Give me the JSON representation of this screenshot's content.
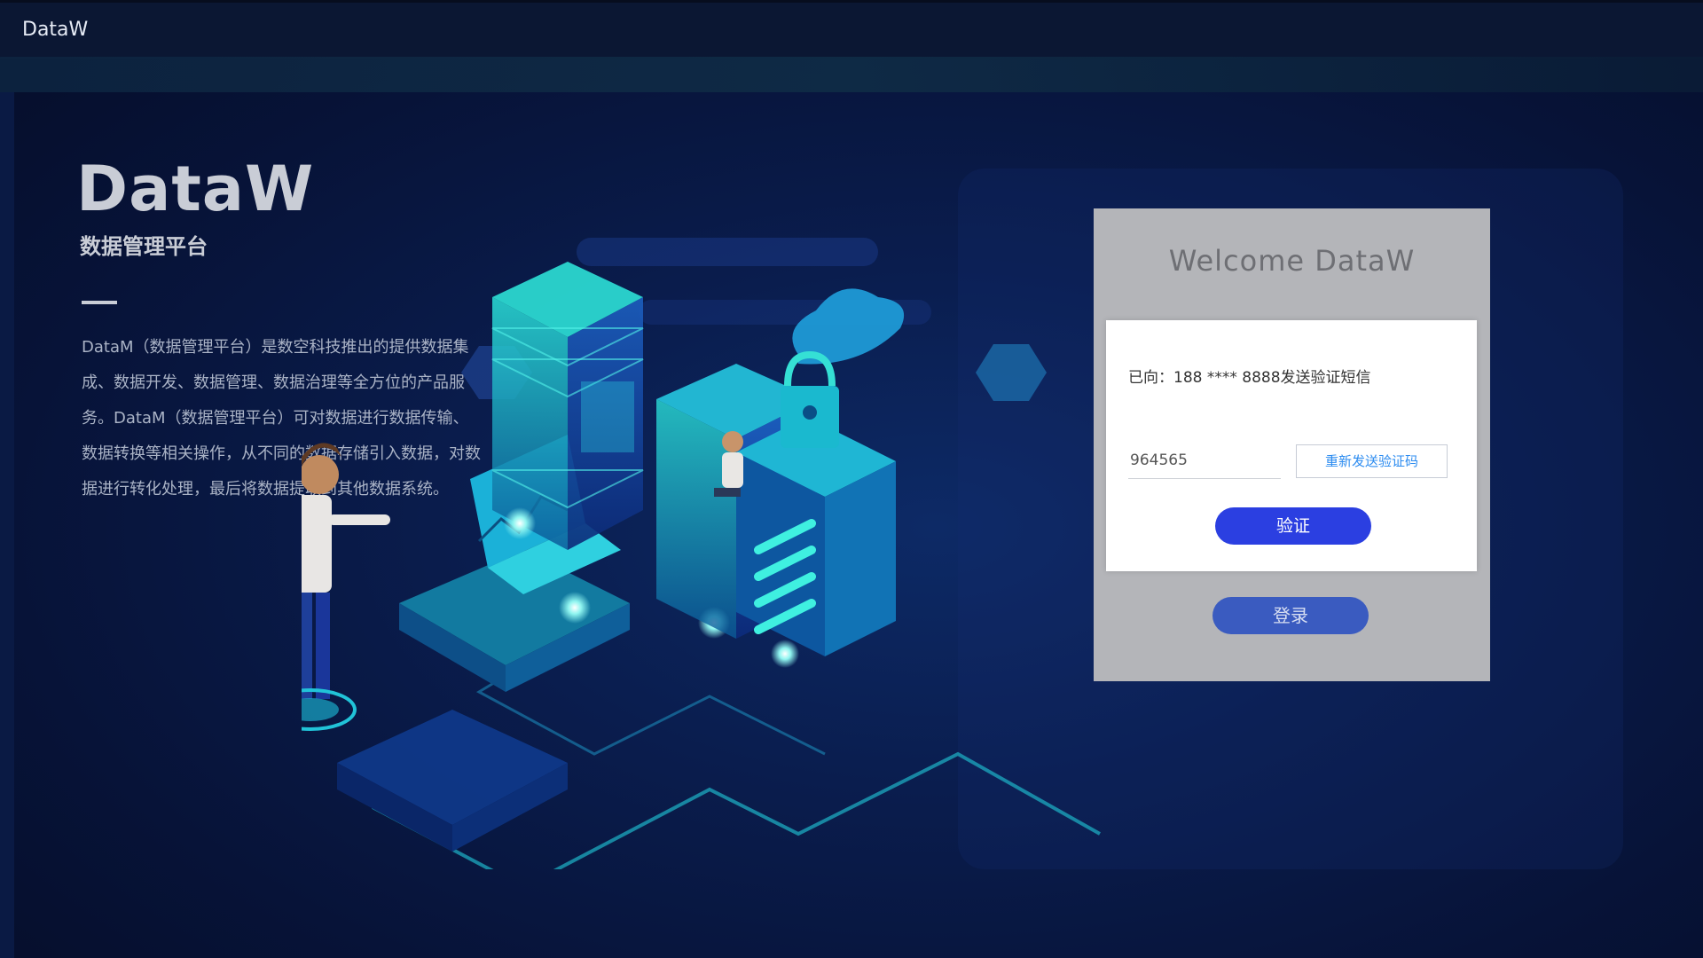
{
  "app": {
    "title": "DataW"
  },
  "brand": {
    "title": "DataW",
    "subtitle": "数据管理平台",
    "description": "DataM（数据管理平台）是数空科技推出的提供数据集成、数据开发、数据管理、数据治理等全方位的产品服务。DataM（数据管理平台）可对数据进行数据传输、数据转换等相关操作，从不同的数据存储引入数据，对数据进行转化处理，最后将数据提取到其他数据系统。"
  },
  "login": {
    "welcome": "Welcome DataW",
    "login_label": "登录"
  },
  "verify": {
    "message": "已向：188 **** 8888发送验证短信",
    "code_value": "964565",
    "resend_label": "重新发送验证码",
    "verify_label": "验证"
  },
  "colors": {
    "background": "#0a1d4e",
    "verify_button": "#2b3fe1",
    "login_button": "#3a5bc0",
    "resend_text": "#2d8cf0"
  }
}
